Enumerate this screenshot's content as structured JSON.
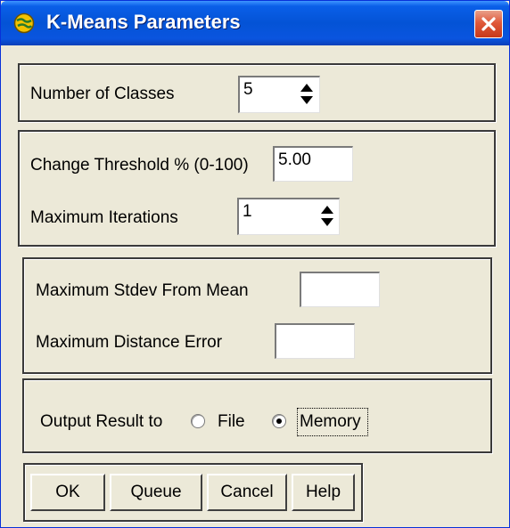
{
  "window": {
    "title": "K-Means Parameters",
    "icon": "globe-icon",
    "close_icon": "close-icon"
  },
  "classes": {
    "label": "Number of Classes",
    "value": "5"
  },
  "threshold": {
    "label": "Change Threshold % (0-100)",
    "value": "5.00"
  },
  "iterations": {
    "label": "Maximum Iterations",
    "value": "1"
  },
  "stdev": {
    "label": "Maximum Stdev From Mean",
    "value": ""
  },
  "distance": {
    "label": "Maximum Distance Error",
    "value": ""
  },
  "output": {
    "label": "Output Result to",
    "options": [
      {
        "label": "File",
        "selected": false
      },
      {
        "label": "Memory",
        "selected": true
      }
    ]
  },
  "buttons": {
    "ok": "OK",
    "queue": "Queue",
    "cancel": "Cancel",
    "help": "Help"
  }
}
